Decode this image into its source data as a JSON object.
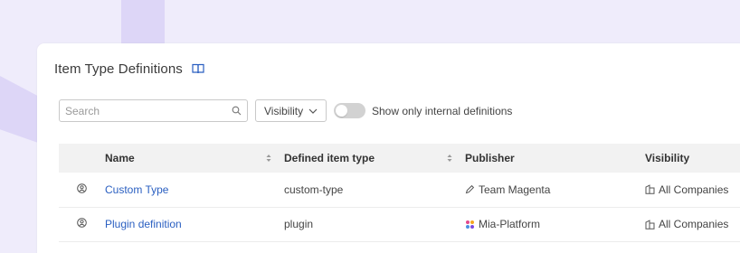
{
  "page": {
    "title": "Item Type Definitions"
  },
  "filters": {
    "search_placeholder": "Search",
    "visibility_label": "Visibility",
    "toggle_label": "Show only internal definitions"
  },
  "table": {
    "columns": [
      "Name",
      "Defined item type",
      "Publisher",
      "Visibility"
    ],
    "rows": [
      {
        "name": "Custom Type",
        "type": "custom-type",
        "publisher": "Team Magenta",
        "publisher_icon": "pen-icon",
        "visibility": "All Companies"
      },
      {
        "name": "Plugin definition",
        "type": "plugin",
        "publisher": "Mia-Platform",
        "publisher_icon": "mia-logo-icon",
        "visibility": "All Companies"
      }
    ]
  },
  "colors": {
    "background": "#efecfb",
    "accent_link": "#2a5fc1",
    "header_bg": "#f2f2f2"
  }
}
